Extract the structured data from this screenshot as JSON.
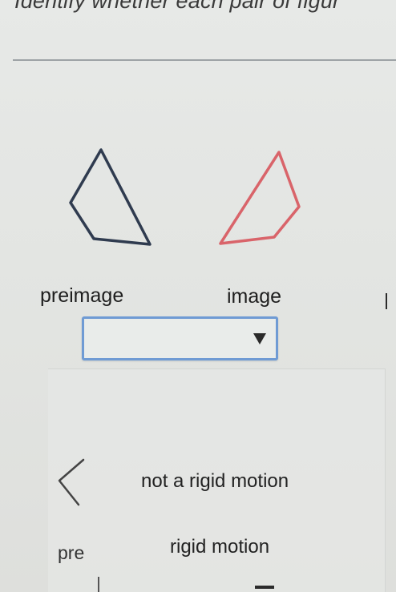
{
  "question": {
    "text": "Identify whether each pair of figur"
  },
  "figure": {
    "preimage_color": "#2f3b4f",
    "image_color": "#d9646a"
  },
  "labels": {
    "preimage": "preimage",
    "image": "image"
  },
  "dropdown": {
    "selected": "",
    "arrow_icon": "triangle-down-icon"
  },
  "options": [
    "not a rigid motion",
    "rigid motion"
  ],
  "partial": {
    "text": "pre"
  },
  "nav": {
    "prev_icon": "chevron-left-icon"
  }
}
